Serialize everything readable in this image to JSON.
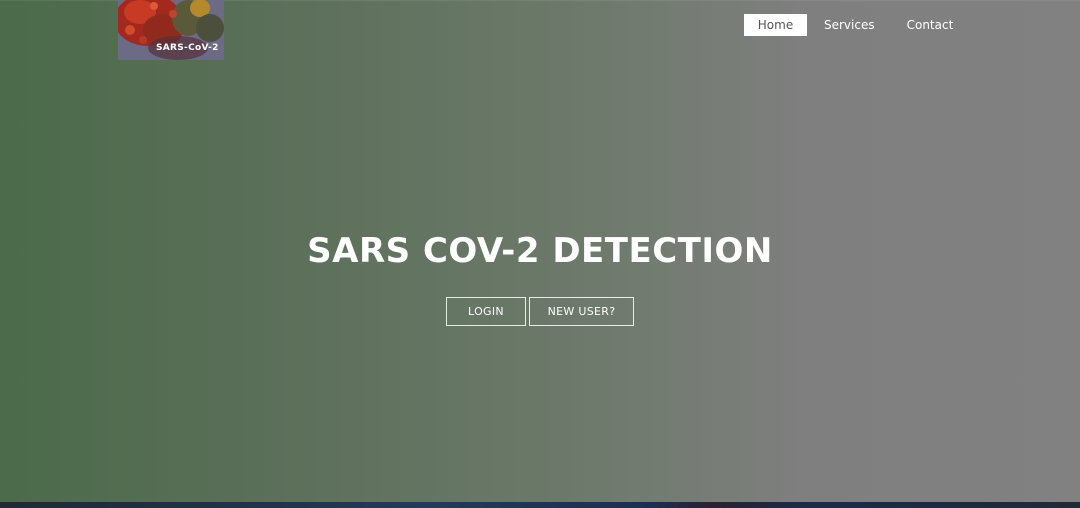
{
  "logo": {
    "text": "SARS-CoV-2",
    "icon": "virus-image"
  },
  "nav": {
    "items": [
      {
        "label": "Home",
        "active": true
      },
      {
        "label": "Services",
        "active": false
      },
      {
        "label": "Contact",
        "active": false
      }
    ]
  },
  "hero": {
    "title": "SARS COV-2 DETECTION",
    "login_label": "LOGIN",
    "new_user_label": "NEW USER?"
  },
  "colors": {
    "gradient_start": "#4b6b4a",
    "gradient_end": "#818181",
    "text": "#ffffff",
    "active_nav_bg": "#ffffff"
  }
}
